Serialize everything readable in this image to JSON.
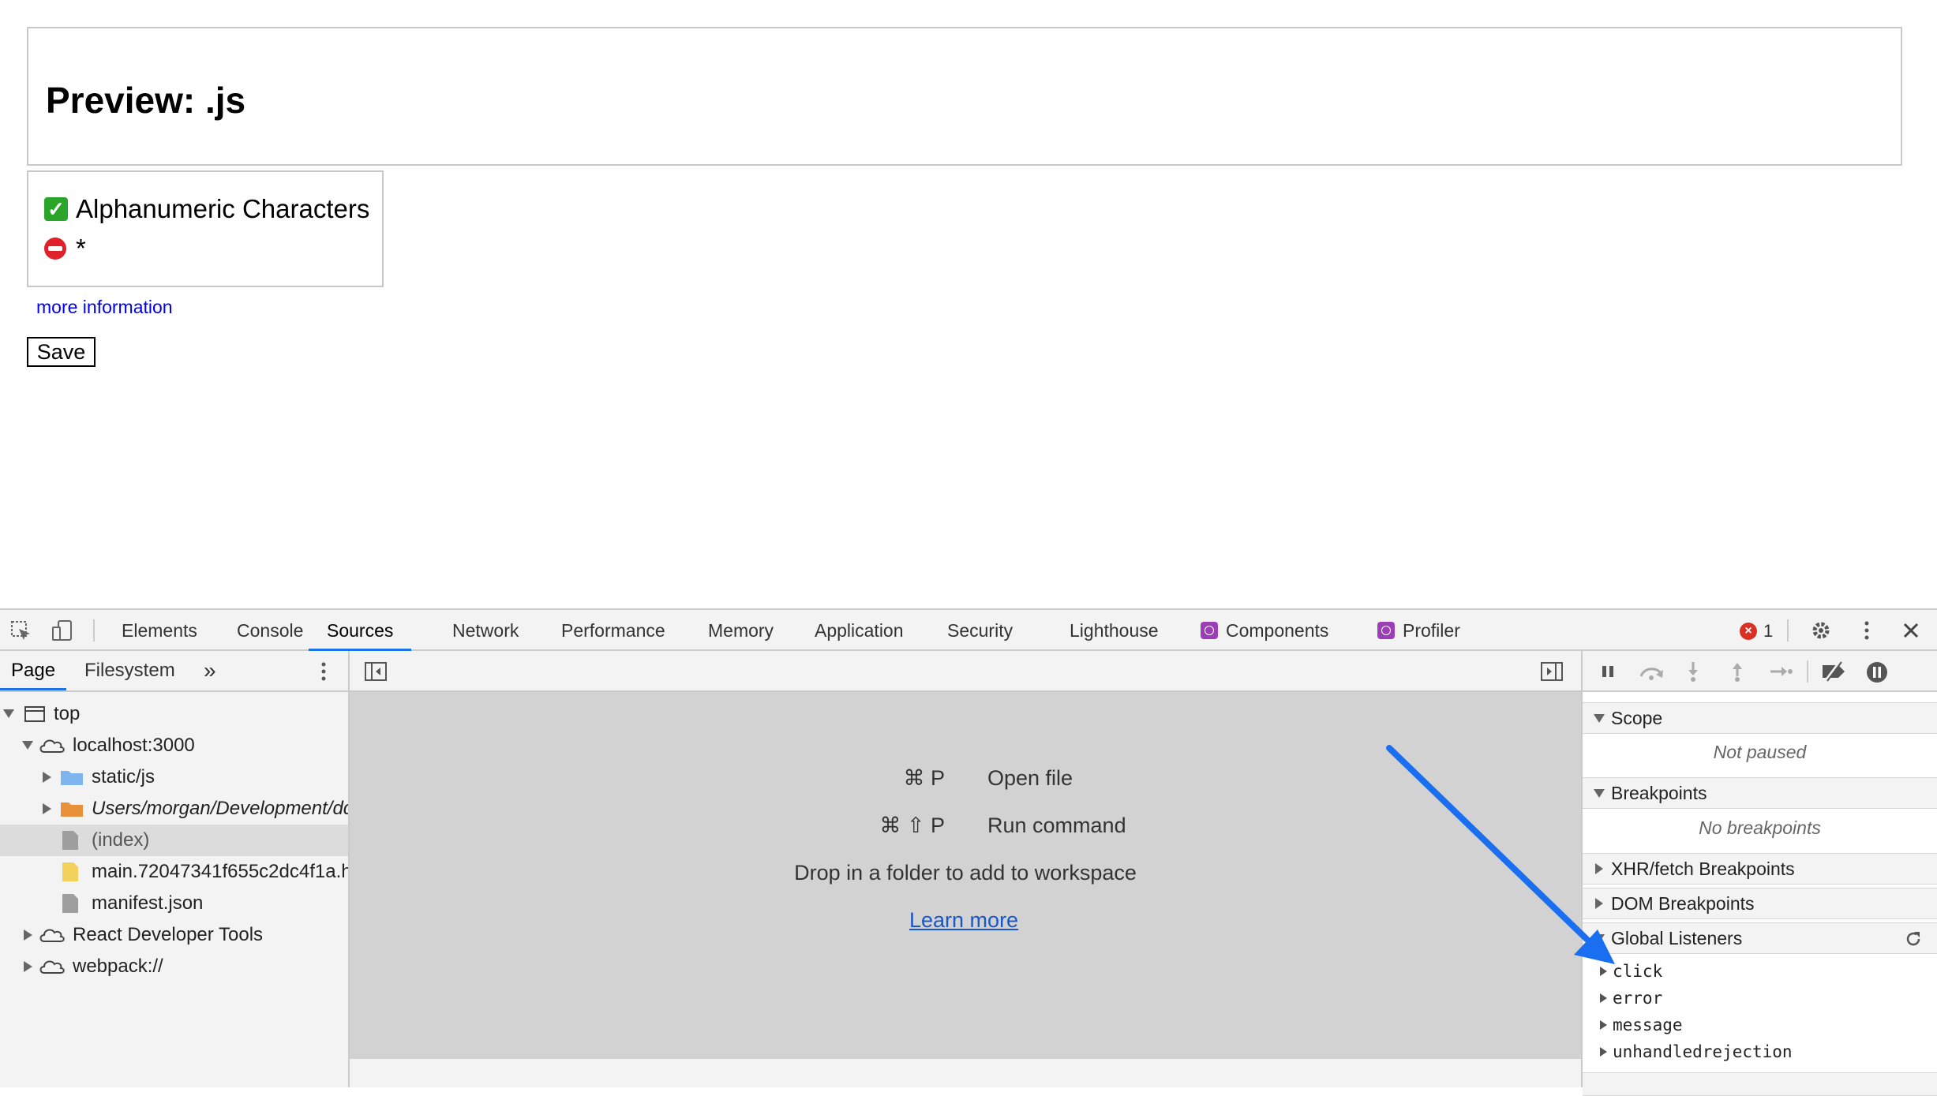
{
  "preview": {
    "title": "Preview: .js",
    "rules": [
      {
        "status": "pass",
        "icon": "check-mark-icon",
        "text": "Alphanumeric Characters"
      },
      {
        "status": "fail",
        "icon": "no-entry-icon",
        "text": "*"
      }
    ],
    "more_info_link": "more information",
    "save_label": "Save"
  },
  "devtools": {
    "tabs": [
      "Elements",
      "Console",
      "Sources",
      "Network",
      "Performance",
      "Memory",
      "Application",
      "Security",
      "Lighthouse",
      "Components",
      "Profiler"
    ],
    "active_tab": "Sources",
    "error_count": "1",
    "navigator": {
      "tabs": [
        "Page",
        "Filesystem"
      ],
      "more_tabs": "»",
      "tree": [
        {
          "label": "top",
          "icon": "frame-icon"
        },
        {
          "label": "localhost:3000",
          "icon": "cloud-icon"
        },
        {
          "label": "static/js",
          "icon": "folder-blue-icon"
        },
        {
          "label": "Users/morgan/Development/dd",
          "icon": "folder-orange-icon"
        },
        {
          "label": "(index)",
          "icon": "file-gray-icon"
        },
        {
          "label": "main.72047341f655c2dc4f1a.h",
          "icon": "file-yellow-icon"
        },
        {
          "label": "manifest.json",
          "icon": "file-gray-icon"
        },
        {
          "label": "React Developer Tools",
          "icon": "cloud-icon"
        },
        {
          "label": "webpack://",
          "icon": "cloud-icon"
        }
      ]
    },
    "editor": {
      "shortcuts": [
        {
          "keys": "⌘ P",
          "action": "Open file"
        },
        {
          "keys": "⌘ ⇧ P",
          "action": "Run command"
        }
      ],
      "drop_hint": "Drop in a folder to add to workspace",
      "learn_more": "Learn more"
    },
    "debugger": {
      "scope_title": "Scope",
      "scope_note": "Not paused",
      "breakpoints_title": "Breakpoints",
      "breakpoints_note": "No breakpoints",
      "xhr_title": "XHR/fetch Breakpoints",
      "dom_title": "DOM Breakpoints",
      "global_title": "Global Listeners",
      "listeners": [
        "click",
        "error",
        "message",
        "unhandledrejection"
      ]
    }
  },
  "colors": {
    "accent": "#1a73e8",
    "annotation_arrow": "#1a6ff0",
    "link": "#0000ee",
    "error": "#d93025"
  }
}
